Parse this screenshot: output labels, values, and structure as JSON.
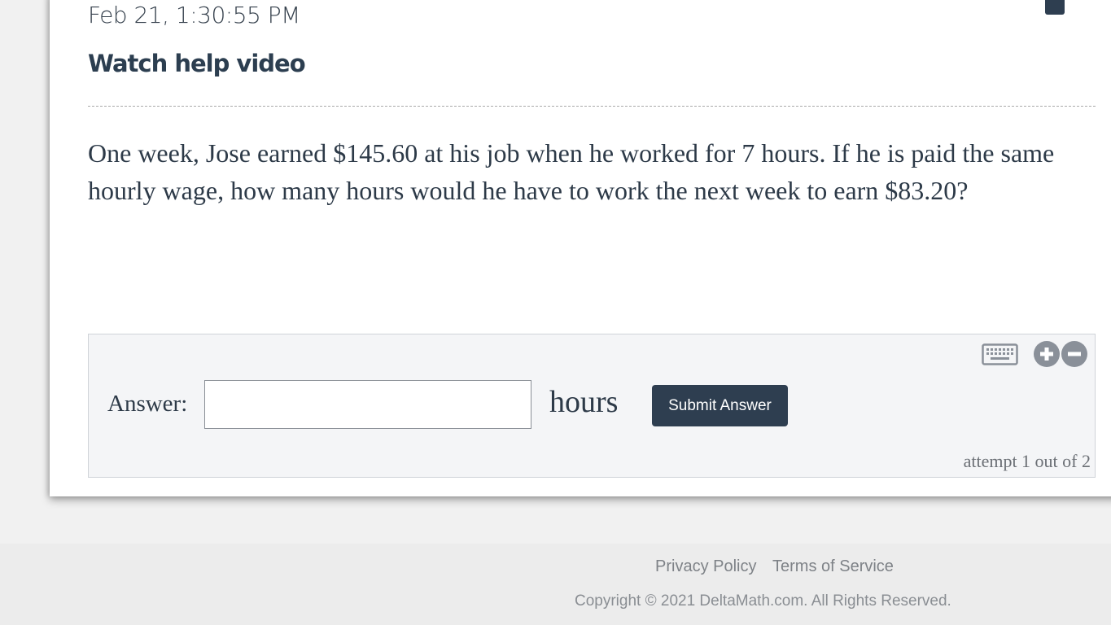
{
  "header": {
    "timestamp": "Feb 21, 1:30:55 PM",
    "help_link": "Watch help video"
  },
  "question": {
    "text": "One week, Jose earned $145.60 at his job when he worked for 7 hours. If he is paid the same hourly wage, how many hours would he have to work the next week to earn $83.20?"
  },
  "answer_panel": {
    "label": "Answer:",
    "input_value": "",
    "input_placeholder": "",
    "unit": "hours",
    "submit_label": "Submit Answer",
    "attempts": "attempt 1 out of 2",
    "icons": [
      "keyboard-icon",
      "zoom-in-icon",
      "zoom-out-icon"
    ]
  },
  "footer": {
    "privacy_label": "Privacy Policy",
    "terms_label": "Terms of Service",
    "copyright": "Copyright © 2021 DeltaMath.com. All Rights Reserved."
  },
  "colors": {
    "primary": "#2e3e50",
    "text": "#2d3a48",
    "panel_bg": "#f4f5f7",
    "icon_gray": "#8a9099"
  }
}
